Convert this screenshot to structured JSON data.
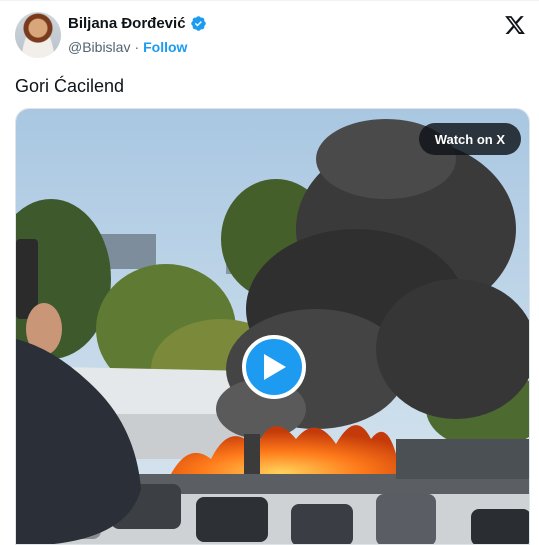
{
  "author": {
    "name": "Biljana Đorđević",
    "handle": "@Bibislav",
    "separator": "·",
    "follow_label": "Follow",
    "verified": true,
    "avatar_icon": "avatar-photo"
  },
  "brand": {
    "logo_icon": "x-logo-icon"
  },
  "tweet": {
    "text": "Gori Ćacilend"
  },
  "media": {
    "type": "video",
    "watch_label": "Watch on X",
    "play_icon": "play-icon",
    "description_colors": {
      "play_button": "#1d9bf0",
      "follow": "#1d9bf0",
      "verified": "#1d9bf0"
    }
  }
}
